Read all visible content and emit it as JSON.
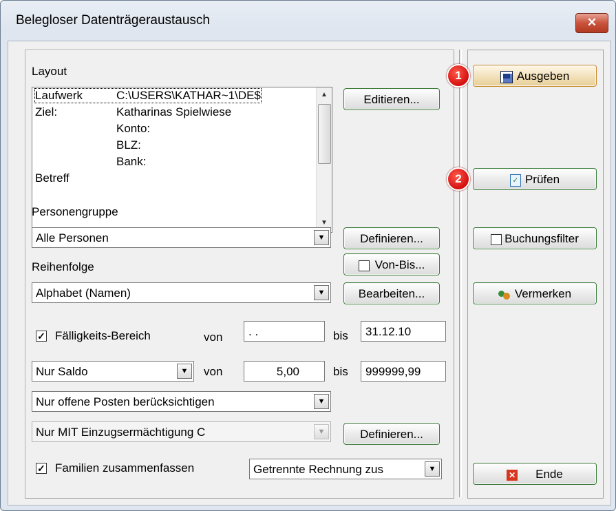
{
  "window": {
    "title": "Belegloser Datenträgeraustausch",
    "close": "✕"
  },
  "layout": {
    "label": "Layout",
    "rows": [
      {
        "key": "Laufwerk",
        "value": "C:\\USERS\\KATHAR~1\\DE$"
      },
      {
        "key": "Ziel:",
        "value": "Katharinas Spielwiese"
      },
      {
        "key": "",
        "value": "Konto:"
      },
      {
        "key": "",
        "value": "BLZ:"
      },
      {
        "key": "",
        "value": "Bank:"
      },
      {
        "key": "Betreff",
        "value": ""
      }
    ],
    "edit_button": "Editieren..."
  },
  "personengruppe": {
    "label": "Personengruppe",
    "value": "Alle Personen",
    "button": "Definieren..."
  },
  "von_bis": {
    "label": "Von-Bis..."
  },
  "reihenfolge": {
    "label": "Reihenfolge",
    "value": "Alphabet (Namen)",
    "button": "Bearbeiten..."
  },
  "faelligkeit": {
    "label": "Fälligkeits-Bereich",
    "von_label": "von",
    "von_value": " . .",
    "bis_label": "bis",
    "bis_value": "31.12.10"
  },
  "saldo": {
    "value": "Nur Saldo",
    "von_label": "von",
    "von_value": "5,00",
    "bis_label": "bis",
    "bis_value": "999999,99"
  },
  "posten": {
    "value": "Nur offene Posten berücksichtigen"
  },
  "einzug": {
    "value": "Nur MIT Einzugsermächtigung C",
    "button": "Definieren..."
  },
  "familien": {
    "label": "Familien zusammenfassen",
    "value": "Getrennte Rechnung zus"
  },
  "actions": {
    "ausgeben": "Ausgeben",
    "pruefen": "Prüfen",
    "buchungsfilter": "Buchungsfilter",
    "vermerken": "Vermerken",
    "ende": "Ende"
  },
  "badges": {
    "one": "1",
    "two": "2"
  }
}
